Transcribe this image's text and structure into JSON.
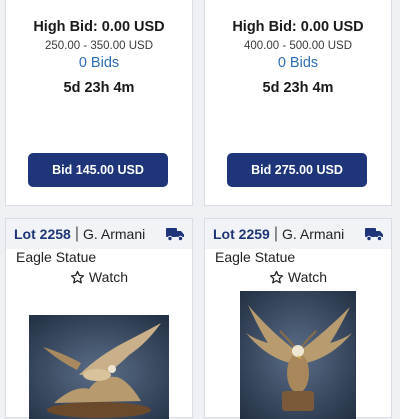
{
  "cards_top": [
    {
      "high_bid": "High Bid: 0.00 USD",
      "estimate": "250.00 - 350.00 USD",
      "bids": "0 Bids",
      "time_left": "5d 23h 4m",
      "bid_button": "Bid 145.00 USD"
    },
    {
      "high_bid": "High Bid: 0.00 USD",
      "estimate": "400.00 - 500.00 USD",
      "bids": "0 Bids",
      "time_left": "5d 23h 4m",
      "bid_button": "Bid 275.00 USD"
    }
  ],
  "cards_bottom": [
    {
      "lot": "Lot 2258",
      "artist": "G. Armani",
      "title": "Eagle Statue",
      "watch": "Watch",
      "shipping_icon": "truck-icon",
      "watch_icon": "star-outline-icon"
    },
    {
      "lot": "Lot 2259",
      "artist": "G. Armani",
      "title": "Eagle Statue",
      "watch": "Watch",
      "shipping_icon": "truck-icon",
      "watch_icon": "star-outline-icon"
    }
  ],
  "colors": {
    "primary": "#1f3579",
    "link": "#2d6db5",
    "header_bg": "#f1f3f6"
  }
}
